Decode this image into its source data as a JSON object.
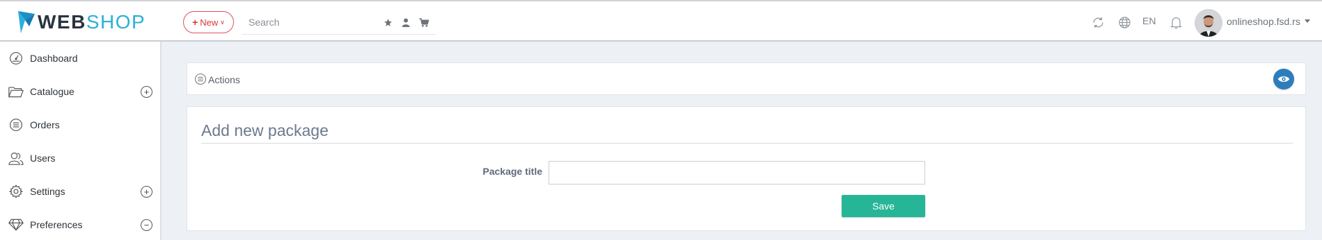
{
  "brand": {
    "name_part1": "WEB",
    "name_part2": "SHOP",
    "accent": "#2ab0d9",
    "dark": "#2a3440"
  },
  "topbar": {
    "new_label": "New",
    "search_placeholder": "Search",
    "search_icons": [
      "star-icon",
      "user-icon",
      "cart-icon"
    ],
    "right_icons": [
      "refresh-icon",
      "globe-icon",
      "bell-icon"
    ],
    "language": "EN",
    "shop_name": "onlineshop.fsd.rs"
  },
  "sidebar": {
    "items": [
      {
        "label": "Dashboard",
        "icon": "gauge-icon",
        "expand": ""
      },
      {
        "label": "Catalogue",
        "icon": "folder-icon",
        "expand": "+"
      },
      {
        "label": "Orders",
        "icon": "list-icon",
        "expand": ""
      },
      {
        "label": "Users",
        "icon": "users-icon",
        "expand": ""
      },
      {
        "label": "Settings",
        "icon": "gear-icon",
        "expand": "+"
      },
      {
        "label": "Preferences",
        "icon": "diamond-icon",
        "expand": "−"
      }
    ]
  },
  "actions": {
    "label": "Actions",
    "eye_color": "#2d7dbb"
  },
  "form": {
    "title": "Add new package",
    "package_title_label": "Package title",
    "package_title_value": "",
    "save_label": "Save",
    "save_color": "#26b596"
  }
}
